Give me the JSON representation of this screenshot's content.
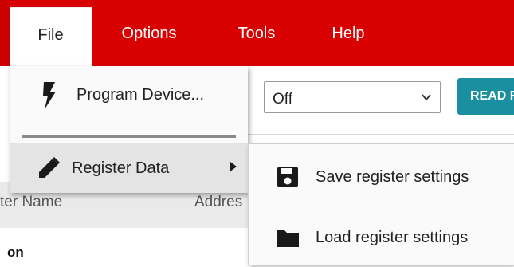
{
  "menubar": {
    "items": [
      {
        "label": "File"
      },
      {
        "label": "Options"
      },
      {
        "label": "Tools"
      },
      {
        "label": "Help"
      }
    ],
    "color": "#d80000"
  },
  "file_menu": {
    "program_label": "Program Device...",
    "register_label": "Register Data"
  },
  "register_submenu": {
    "save_label": "Save register settings",
    "load_label": "Load register settings"
  },
  "background": {
    "select_value": "Off",
    "read_button_label": "READ R",
    "column_name_partial": "ter Name",
    "column_address_partial": "Addres",
    "row_label_partial": "on"
  }
}
